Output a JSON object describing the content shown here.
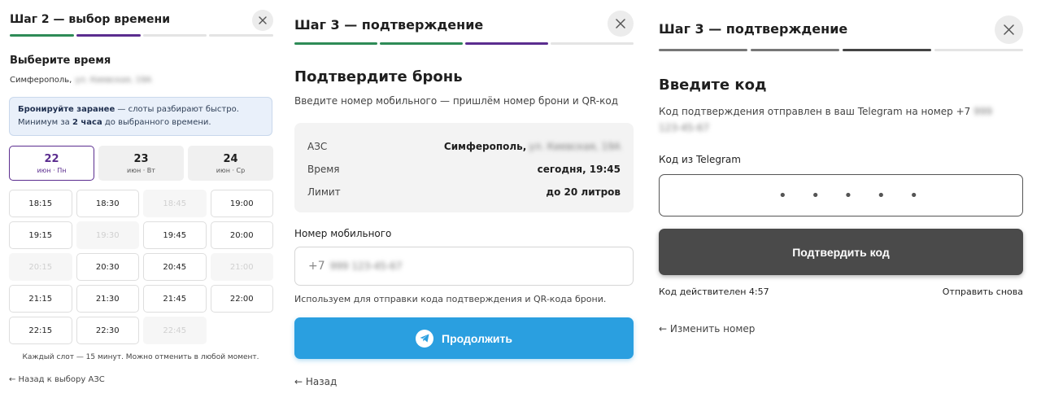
{
  "colors": {
    "green": "#2e8b57",
    "purple": "#5b2d8f",
    "gray_track": "#e4e4e4",
    "telegram_blue": "#2a9fe0",
    "dark_button": "#4a4a4a"
  },
  "panel1": {
    "title": "Шаг 2 — выбор времени",
    "close_icon": "close-icon",
    "heading": "Выберите время",
    "address_city": "Симферополь,",
    "address_hidden": "ул. Киевская, 19А",
    "notice": {
      "bold1": "Бронируйте заранее",
      "text1": " — слоты разбирают быстро. Минимум за ",
      "bold2": "2 часа",
      "text2": " до выбранного времени."
    },
    "days": [
      {
        "num": "22",
        "sub": "июн · Пн",
        "selected": true
      },
      {
        "num": "23",
        "sub": "июн · Вт",
        "selected": false
      },
      {
        "num": "24",
        "sub": "июн · Ср",
        "selected": false
      }
    ],
    "slots": [
      {
        "t": "18:15",
        "disabled": false
      },
      {
        "t": "18:30",
        "disabled": false
      },
      {
        "t": "18:45",
        "disabled": true
      },
      {
        "t": "19:00",
        "disabled": false
      },
      {
        "t": "19:15",
        "disabled": false
      },
      {
        "t": "19:30",
        "disabled": true
      },
      {
        "t": "19:45",
        "disabled": false
      },
      {
        "t": "20:00",
        "disabled": false
      },
      {
        "t": "20:15",
        "disabled": true
      },
      {
        "t": "20:30",
        "disabled": false
      },
      {
        "t": "20:45",
        "disabled": false
      },
      {
        "t": "21:00",
        "disabled": true
      },
      {
        "t": "21:15",
        "disabled": false
      },
      {
        "t": "21:30",
        "disabled": false
      },
      {
        "t": "21:45",
        "disabled": false
      },
      {
        "t": "22:00",
        "disabled": false
      },
      {
        "t": "22:15",
        "disabled": false
      },
      {
        "t": "22:30",
        "disabled": false
      },
      {
        "t": "22:45",
        "disabled": true
      }
    ],
    "footer_note": "Каждый слот — 15 минут. Можно отменить в любой момент.",
    "back_link": "← Назад к выбору АЗС"
  },
  "panel2": {
    "title": "Шаг 3 — подтверждение",
    "heading": "Подтвердите бронь",
    "subheading": "Введите номер мобильного — пришлём номер брони и QR-код",
    "summary": {
      "station_label": "АЗС",
      "station_city": "Симферополь,",
      "station_hidden": "ул. Киевская, 19А",
      "time_label": "Время",
      "time_value": "сегодня, 19:45",
      "limit_label": "Лимит",
      "limit_value": "до 20 литров"
    },
    "phone_label": "Номер мобильного",
    "phone_prefix": "+7",
    "phone_hidden": "999 123-45-67",
    "hint": "Используем для отправки кода подтверждения и QR-кода брони.",
    "continue_label": "Продолжить",
    "telegram_icon": "telegram-icon",
    "back_link": "← Назад"
  },
  "panel3": {
    "title": "Шаг 3 — подтверждение",
    "heading": "Введите код",
    "subheading": "Код подтверждения отправлен в ваш Telegram на номер +7",
    "subheading_hidden": "999 123-45-67",
    "code_label": "Код из Telegram",
    "code_value": "• • • • •",
    "confirm_label": "Подтвердить код",
    "timer_text": "Код действителен 4:57",
    "resend_label": "Отправить снова",
    "back_link": "← Изменить номер"
  }
}
